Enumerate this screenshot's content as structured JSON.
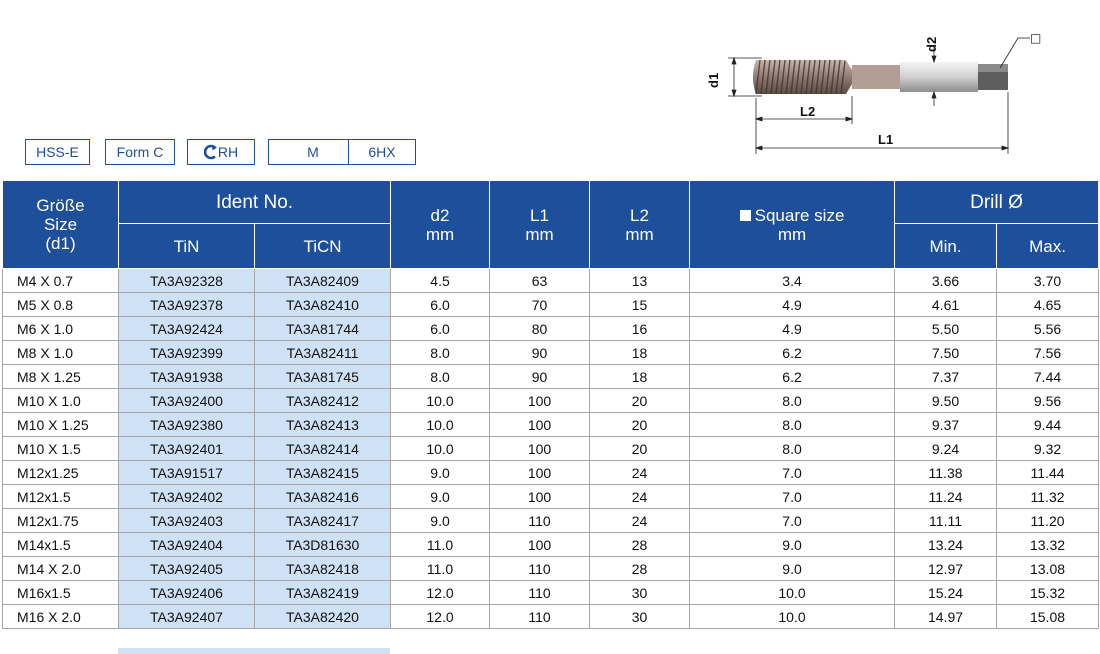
{
  "badges": [
    {
      "label": "HSS-E"
    },
    {
      "label": "Form C"
    },
    {
      "label": "RH",
      "icon": "right-hand-rotation-icon"
    },
    {
      "label": "M"
    },
    {
      "label": "6HX"
    }
  ],
  "drawing": {
    "labels": {
      "d1": "d1",
      "d2": "d2",
      "l2": "L2",
      "l1": "L1",
      "square": "□"
    }
  },
  "table": {
    "headers": {
      "size": [
        "Größe",
        "Size",
        "(d1)"
      ],
      "ident": "Ident No.",
      "tin": "TiN",
      "ticn": "TiCN",
      "d2": [
        "d2",
        "mm"
      ],
      "l1": [
        "L1",
        "mm"
      ],
      "l2": [
        "L2",
        "mm"
      ],
      "square": [
        "Square size",
        "mm"
      ],
      "drill": "Drill Ø",
      "min": "Min.",
      "max": "Max."
    },
    "rows": [
      {
        "size": "M4 X 0.7",
        "tin": "TA3A92328",
        "ticn": "TA3A82409",
        "d2": "4.5",
        "l1": "63",
        "l2": "13",
        "square": "3.4",
        "min": "3.66",
        "max": "3.70"
      },
      {
        "size": "M5 X 0.8",
        "tin": "TA3A92378",
        "ticn": "TA3A82410",
        "d2": "6.0",
        "l1": "70",
        "l2": "15",
        "square": "4.9",
        "min": "4.61",
        "max": "4.65"
      },
      {
        "size": "M6 X 1.0",
        "tin": "TA3A92424",
        "ticn": "TA3A81744",
        "d2": "6.0",
        "l1": "80",
        "l2": "16",
        "square": "4.9",
        "min": "5.50",
        "max": "5.56"
      },
      {
        "size": "M8 X 1.0",
        "tin": "TA3A92399",
        "ticn": "TA3A82411",
        "d2": "8.0",
        "l1": "90",
        "l2": "18",
        "square": "6.2",
        "min": "7.50",
        "max": "7.56"
      },
      {
        "size": "M8 X 1.25",
        "tin": "TA3A91938",
        "ticn": "TA3A81745",
        "d2": "8.0",
        "l1": "90",
        "l2": "18",
        "square": "6.2",
        "min": "7.37",
        "max": "7.44"
      },
      {
        "size": "M10 X 1.0",
        "tin": "TA3A92400",
        "ticn": "TA3A82412",
        "d2": "10.0",
        "l1": "100",
        "l2": "20",
        "square": "8.0",
        "min": "9.50",
        "max": "9.56"
      },
      {
        "size": "M10 X 1.25",
        "tin": "TA3A92380",
        "ticn": "TA3A82413",
        "d2": "10.0",
        "l1": "100",
        "l2": "20",
        "square": "8.0",
        "min": "9.37",
        "max": "9.44"
      },
      {
        "size": "M10 X 1.5",
        "tin": "TA3A92401",
        "ticn": "TA3A82414",
        "d2": "10.0",
        "l1": "100",
        "l2": "20",
        "square": "8.0",
        "min": "9.24",
        "max": "9.32"
      },
      {
        "size": "M12x1.25",
        "tin": "TA3A91517",
        "ticn": "TA3A82415",
        "d2": "9.0",
        "l1": "100",
        "l2": "24",
        "square": "7.0",
        "min": "11.38",
        "max": "11.44"
      },
      {
        "size": "M12x1.5",
        "tin": "TA3A92402",
        "ticn": "TA3A82416",
        "d2": "9.0",
        "l1": "100",
        "l2": "24",
        "square": "7.0",
        "min": "11.24",
        "max": "11.32"
      },
      {
        "size": "M12x1.75",
        "tin": "TA3A92403",
        "ticn": "TA3A82417",
        "d2": "9.0",
        "l1": "110",
        "l2": "24",
        "square": "7.0",
        "min": "11.11",
        "max": "11.20"
      },
      {
        "size": "M14x1.5",
        "tin": "TA3A92404",
        "ticn": "TA3D81630",
        "d2": "11.0",
        "l1": "100",
        "l2": "28",
        "square": "9.0",
        "min": "13.24",
        "max": "13.32"
      },
      {
        "size": "M14 X 2.0",
        "tin": "TA3A92405",
        "ticn": "TA3A82418",
        "d2": "11.0",
        "l1": "110",
        "l2": "28",
        "square": "9.0",
        "min": "12.97",
        "max": "13.08"
      },
      {
        "size": "M16x1.5",
        "tin": "TA3A92406",
        "ticn": "TA3A82419",
        "d2": "12.0",
        "l1": "110",
        "l2": "30",
        "square": "10.0",
        "min": "15.24",
        "max": "15.32"
      },
      {
        "size": "M16 X 2.0",
        "tin": "TA3A92407",
        "ticn": "TA3A82420",
        "d2": "12.0",
        "l1": "110",
        "l2": "30",
        "square": "10.0",
        "min": "14.97",
        "max": "15.08"
      }
    ]
  },
  "colors": {
    "header_blue": "#1d4f9a",
    "ident_highlight": "#cfe2f5",
    "grid": "#a6a6a6"
  }
}
